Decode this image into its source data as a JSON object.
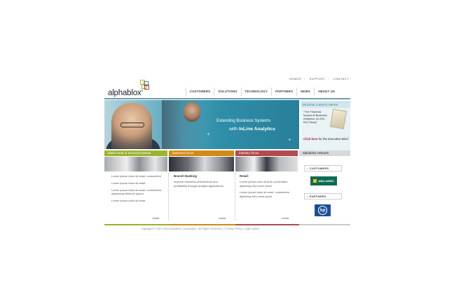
{
  "util_nav": [
    "DEMOS",
    "SUPPORT",
    "CONTACT"
  ],
  "logo": {
    "text": "alphablox",
    "tm": "®"
  },
  "main_nav": [
    "CUSTOMERS",
    "SOLUTIONS",
    "TECHNOLOGY",
    "PARTNERS",
    "NEWS",
    "ABOUT US"
  ],
  "hero": {
    "headline": "Extending Business Systems",
    "sub_prefix": "with ",
    "sub_bold": "InLine Analytics"
  },
  "white_paper": {
    "head": "RECEIVE A WHITE PAPER",
    "quote": "“The Financial Impact of Business Analytics: An IDC ROI Study”",
    "click_bold": "Click here",
    "click_rest": " for the Executive Brief"
  },
  "sections": {
    "news": "latest news & announcements",
    "biz": "business focus",
    "ind": "industry focus",
    "net": "alphablox network"
  },
  "news_items": [
    "Lorem ipsum dolor sit amet, consectetur",
    "Lorem ipsum dolor sit amet",
    "Lorem ipsum dolor sit amet, consectetur adipiscing elitlorem ipsum",
    "Lorem ipsum dolor sit amet"
  ],
  "biz": {
    "title": "Branch Banking",
    "text": "Improve business performance and profitability through analytic applications"
  },
  "ind": {
    "title": "Retail:",
    "p1": "Lorem ipsum color sit ame consectetur dipisicing elit-Lorem psum",
    "p2": "Lorem ipsum dolor sit amet, consectetur dipisicing elit-Lorem psum"
  },
  "more_label": "more",
  "network": {
    "customers": "CUSTOMERS",
    "partners": "PARTNERS",
    "customer_logo": "ABN·AMRO",
    "partner_logo": "hp"
  },
  "footer": {
    "copyright": "Copyright © 2001-2004 Alphablox Corporation. All Rights Reserved.",
    "privacy": "Privacy Policy",
    "legal": "Legal Notice"
  }
}
